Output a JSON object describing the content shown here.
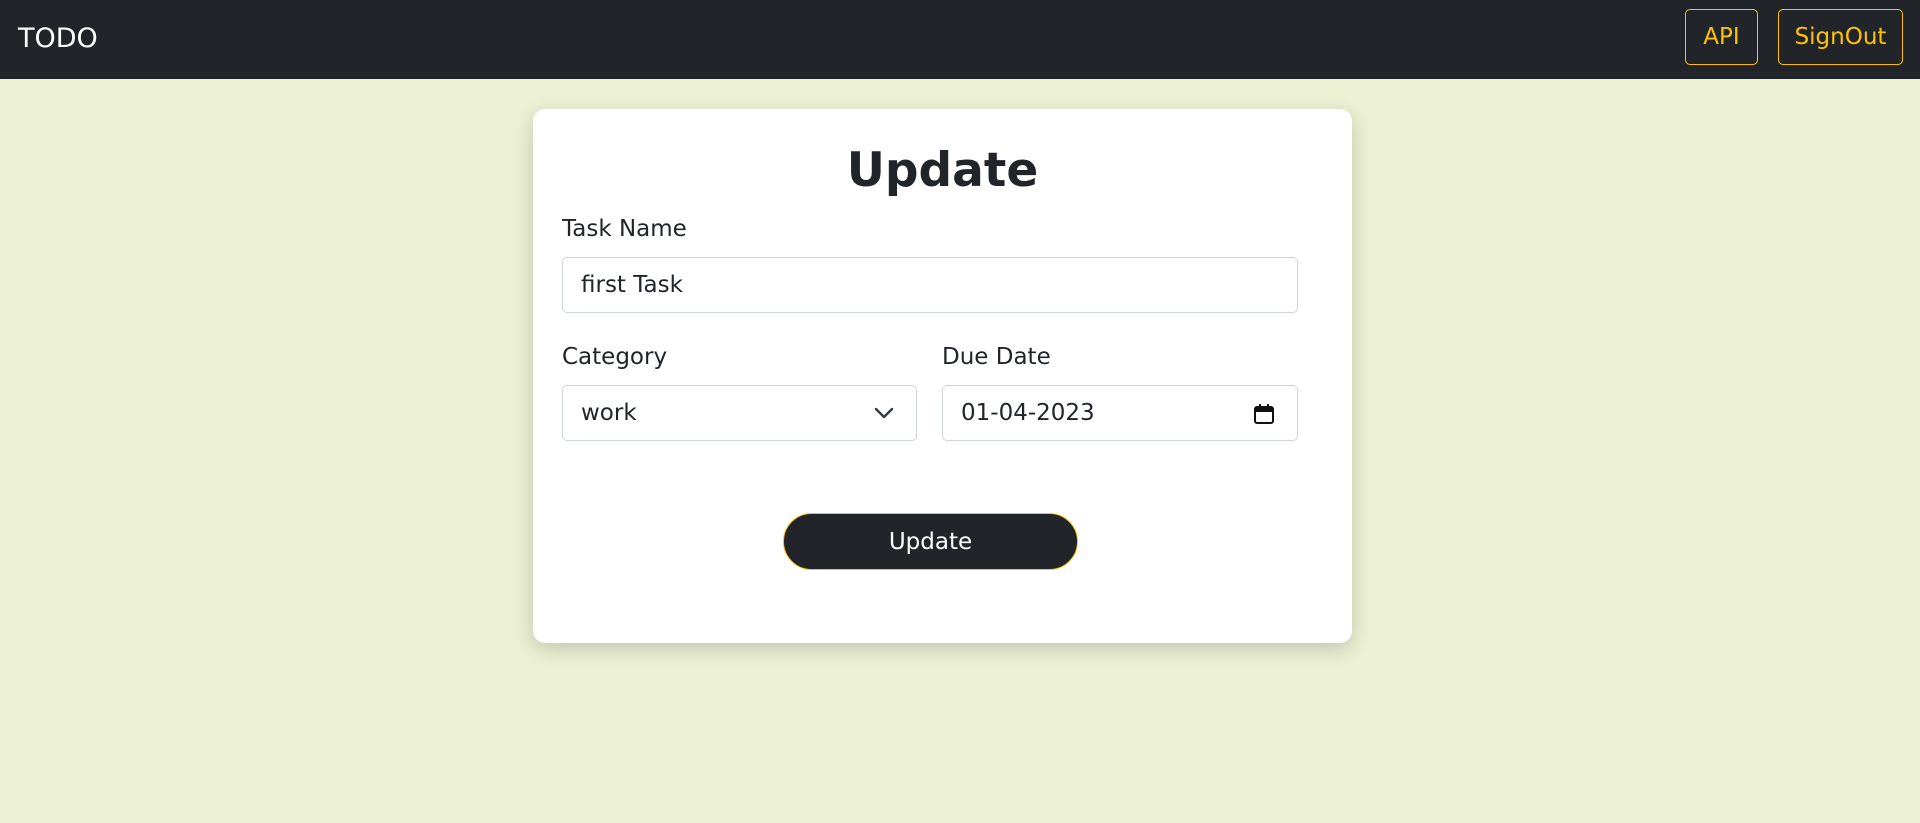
{
  "navbar": {
    "brand": "TODO",
    "buttons": [
      {
        "label": "API"
      },
      {
        "label": "SignOut"
      }
    ]
  },
  "form": {
    "title": "Update",
    "task_name": {
      "label": "Task Name",
      "value": "first Task"
    },
    "category": {
      "label": "Category",
      "selected": "work"
    },
    "due_date": {
      "label": "Due Date",
      "value": "01-04-2023"
    },
    "submit_label": "Update"
  },
  "colors": {
    "navbar_bg": "#212529",
    "accent": "#ffc107",
    "page_bg": "#ecf1d3",
    "card_bg": "#ffffff"
  },
  "icons": {
    "category_dropdown": "chevron-down-icon",
    "due_date_picker": "calendar-icon"
  }
}
